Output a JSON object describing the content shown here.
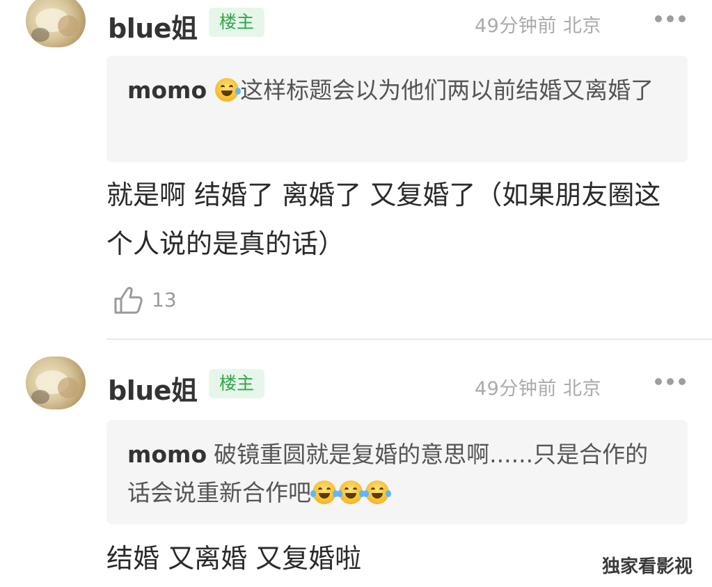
{
  "comments": [
    {
      "username": "blue姐",
      "badge": "楼主",
      "time": "49分钟前",
      "location": "北京",
      "quote_user": "momo",
      "quote_text": "这样标题会以为他们两以前结婚又离婚了",
      "body": "就是啊 结婚了 离婚了 又复婚了（如果朋友圈这个人说的是真的话）",
      "likes": "13"
    },
    {
      "username": "blue姐",
      "badge": "楼主",
      "time": "49分钟前",
      "location": "北京",
      "quote_user": "momo",
      "quote_text": "破镜重圆就是复婚的意思啊......只是合作的话会说重新合作吧",
      "body": "结婚 又离婚 又复婚啦"
    }
  ],
  "watermark": "独家看影视",
  "icons": {
    "more": "more-dots-icon",
    "like": "thumb-up-icon",
    "emoji_sweat": "grinning-sweat-emoji-icon",
    "emoji_laugh": "laughing-tears-emoji-icon"
  },
  "colors": {
    "badge_bg": "#e7f6ea",
    "badge_text": "#2fa64a",
    "quote_bg": "#f5f5f5",
    "meta_text": "#aaaaaa"
  }
}
